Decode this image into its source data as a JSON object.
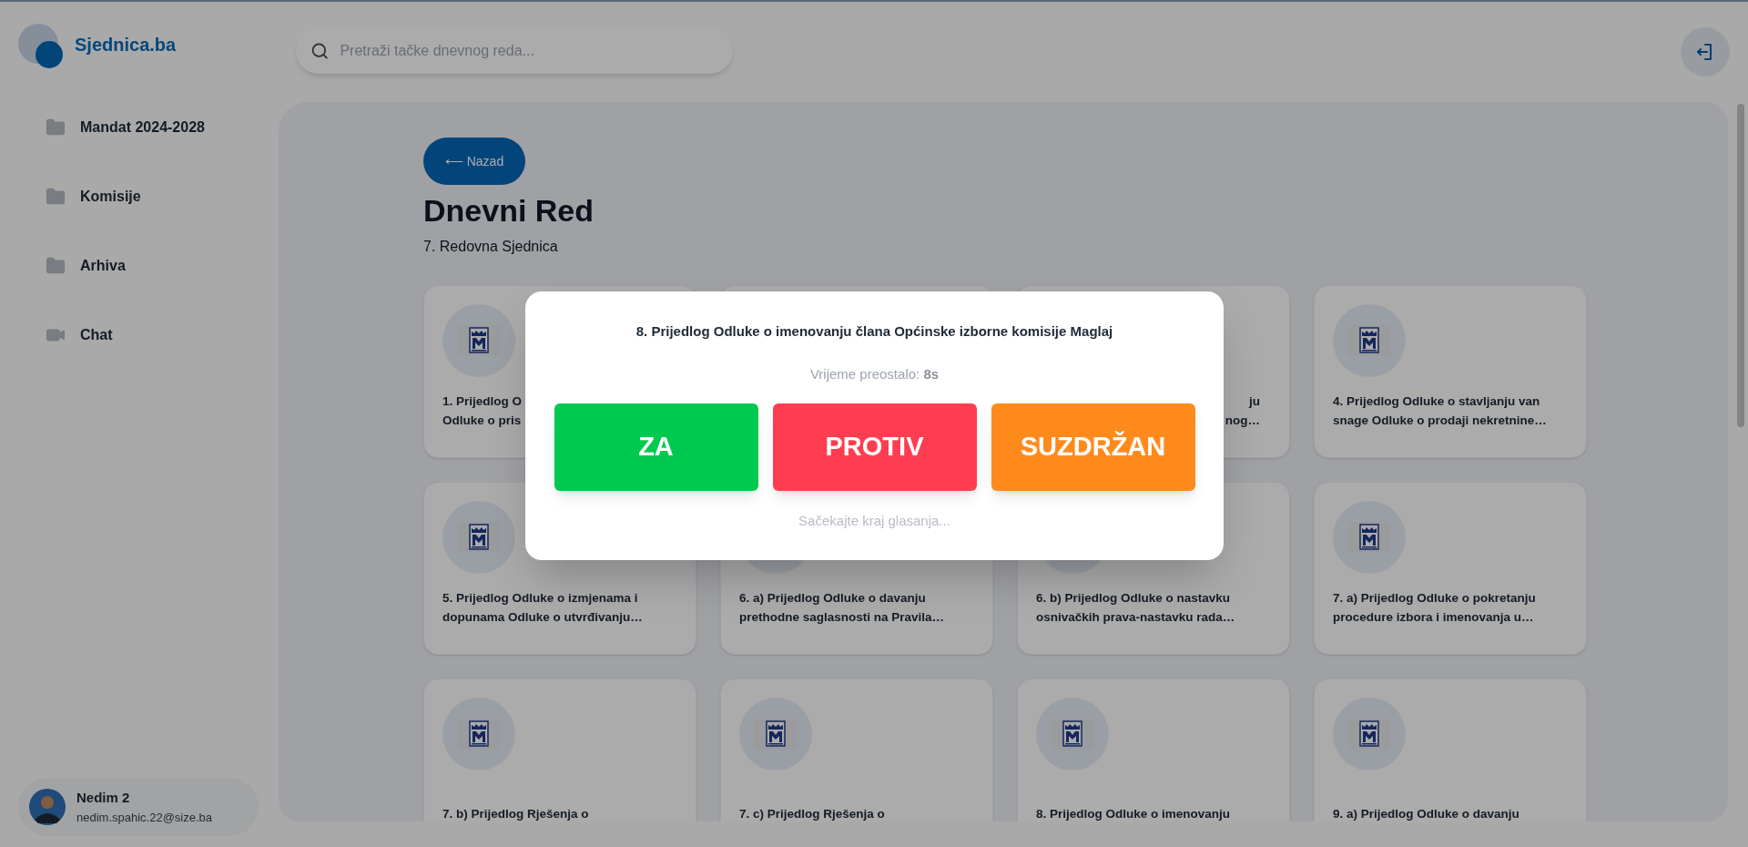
{
  "brand": {
    "name": "Sjednica.ba"
  },
  "search": {
    "placeholder": "Pretraži tačke dnevnog reda..."
  },
  "sidebar": {
    "items": [
      {
        "label": "Mandat 2024-2028",
        "kind": "folder"
      },
      {
        "label": "Komisije",
        "kind": "folder"
      },
      {
        "label": "Arhiva",
        "kind": "folder"
      },
      {
        "label": "Chat",
        "kind": "video"
      }
    ]
  },
  "user": {
    "name": "Nedim 2",
    "email": "nedim.spahic.22@size.ba"
  },
  "back_button": {
    "label": "⟵ Nazad"
  },
  "page": {
    "title": "Dnevni Red",
    "subtitle": "7. Redovna Sjednica"
  },
  "cards": [
    {
      "kind": "left_visible",
      "title_lines": [
        "1. Prijedlog O",
        "Odluke o pris"
      ]
    },
    {
      "kind": "covered"
    },
    {
      "kind": "right_visible",
      "title_lines": [
        "ju",
        "nog…"
      ]
    },
    {
      "kind": "full",
      "title_lines": [
        "4. Prijedlog Odluke o stavljanju van",
        "snage Odluke o prodaji nekretnine…"
      ]
    },
    {
      "kind": "full",
      "title_lines": [
        "5. Prijedlog Odluke o izmjenama i",
        "dopunama Odluke o utvrđivanju…"
      ]
    },
    {
      "kind": "crest_covered",
      "title_lines": [
        "6. a) Prijedlog Odluke o davanju",
        "prethodne saglasnosti na Pravila…"
      ]
    },
    {
      "kind": "crest_covered",
      "title_lines": [
        "6. b) Prijedlog Odluke o nastavku",
        "osnivačkih prava-nastavku rada…"
      ]
    },
    {
      "kind": "full",
      "title_lines": [
        "7. a) Prijedlog Odluke o pokretanju",
        "procedure izbora i imenovanja u…"
      ]
    },
    {
      "kind": "full",
      "title_lines": [
        "7. b) Prijedlog Rješenja o"
      ]
    },
    {
      "kind": "full",
      "title_lines": [
        "7. c) Prijedlog Rješenja o"
      ]
    },
    {
      "kind": "full",
      "title_lines": [
        "8. Prijedlog Odluke o imenovanju"
      ]
    },
    {
      "kind": "full",
      "title_lines": [
        "9. a) Prijedlog Odluke o davanju"
      ]
    }
  ],
  "vote_dialog": {
    "title": "8. Prijedlog Odluke o imenovanju člana Općinske izborne komisije Maglaj",
    "timer_label": "Vrijeme preostalo:",
    "timer_value": "8s",
    "options": [
      {
        "label": "ZA",
        "kind": "for"
      },
      {
        "label": "PROTIV",
        "kind": "against"
      },
      {
        "label": "SUZDRŽAN",
        "kind": "abstain"
      }
    ],
    "footer": "Sačekajte kraj glasanja..."
  }
}
